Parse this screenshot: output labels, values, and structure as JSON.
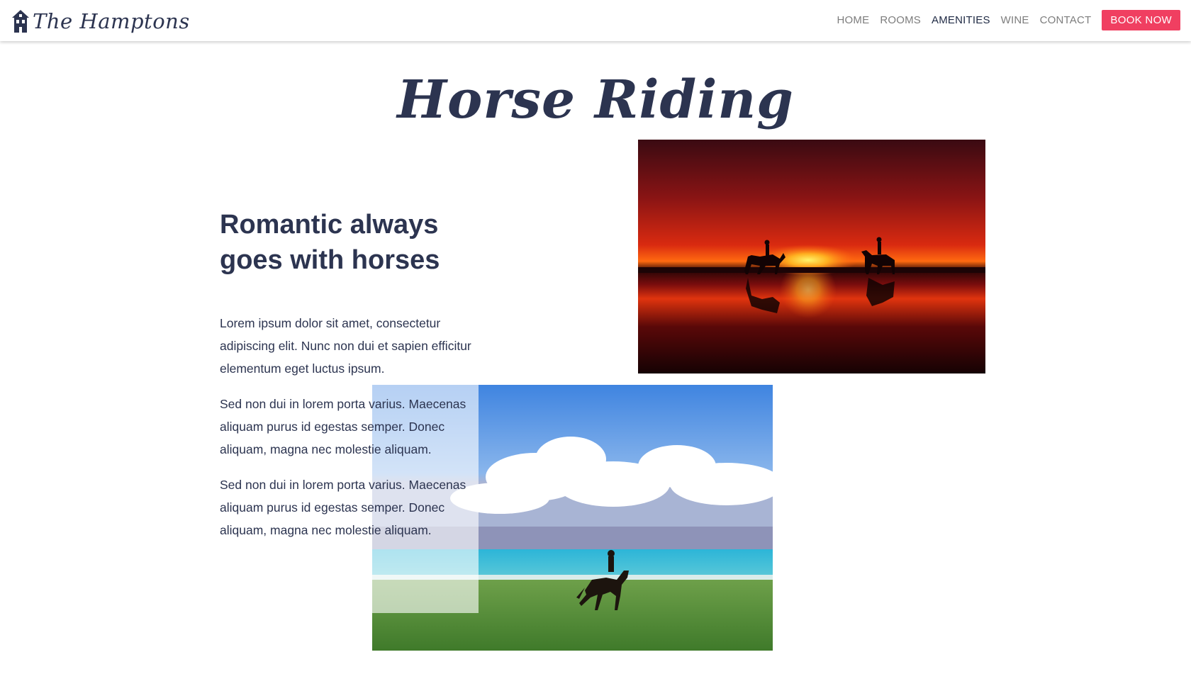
{
  "brand": {
    "name": "The Hamptons",
    "logo_icon": "house-icon"
  },
  "nav": {
    "items": [
      {
        "label": "HOME",
        "active": false
      },
      {
        "label": "ROOMS",
        "active": false
      },
      {
        "label": "AMENITIES",
        "active": true
      },
      {
        "label": "WINE",
        "active": false
      },
      {
        "label": "CONTACT",
        "active": false
      }
    ],
    "book_label": "BOOK NOW"
  },
  "page": {
    "title": "Horse Riding",
    "heading_line1": "Romantic always",
    "heading_line2": "goes with horses",
    "paragraphs": [
      "Lorem ipsum dolor sit amet, consectetur adipiscing elit. Nunc non dui et sapien efficitur elementum eget luctus ipsum.",
      "Sed non dui in lorem porta varius. Maecenas aliquam purus id egestas semper. Donec aliquam, magna nec molestie aliquam.",
      "Sed non dui in lorem porta varius. Maecenas aliquam purus id egestas semper. Donec aliquam, magna nec molestie aliquam."
    ]
  },
  "colors": {
    "primary_text": "#2c3450",
    "nav_text": "#7d7d7d",
    "accent": "#f03f61"
  }
}
